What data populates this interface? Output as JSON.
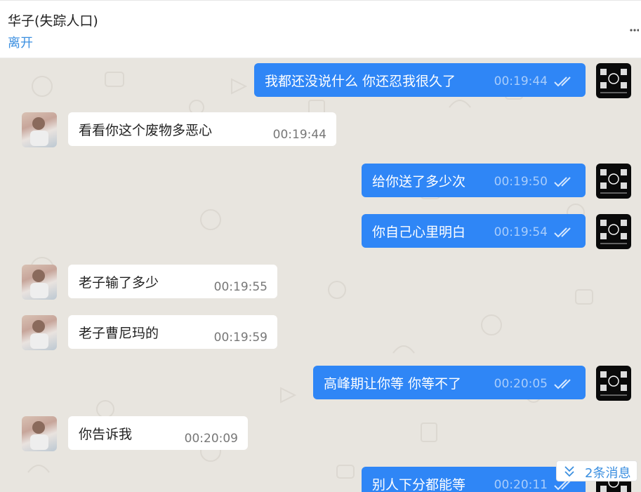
{
  "header": {
    "title": "华子(失踪人口)",
    "status": "离开"
  },
  "messages": [
    {
      "dir": "out",
      "text": "我都还没说什么 你还忍我很久了",
      "time": "00:19:44"
    },
    {
      "dir": "in",
      "text": "看看你这个废物多恶心",
      "time": "00:19:44"
    },
    {
      "dir": "out",
      "text": "给你送了多少次",
      "time": "00:19:50"
    },
    {
      "dir": "out",
      "text": "你自己心里明白",
      "time": "00:19:54"
    },
    {
      "dir": "in",
      "text": "老子输了多少",
      "time": "00:19:55"
    },
    {
      "dir": "in",
      "text": "老子曹尼玛的",
      "time": "00:19:59"
    },
    {
      "dir": "out",
      "text": "高峰期让你等 你等不了",
      "time": "00:20:05"
    },
    {
      "dir": "in",
      "text": "你告诉我",
      "time": "00:20:09"
    },
    {
      "dir": "out",
      "text": "别人下分都能等",
      "time": "00:20:11"
    }
  ],
  "new_messages": {
    "label": "2条消息",
    "icon": "double-chevron-down-icon"
  },
  "colors": {
    "outgoing_bubble": "#2f86f6",
    "incoming_bubble": "#ffffff",
    "chat_background": "#e8e5df",
    "link": "#3b8fe0"
  }
}
